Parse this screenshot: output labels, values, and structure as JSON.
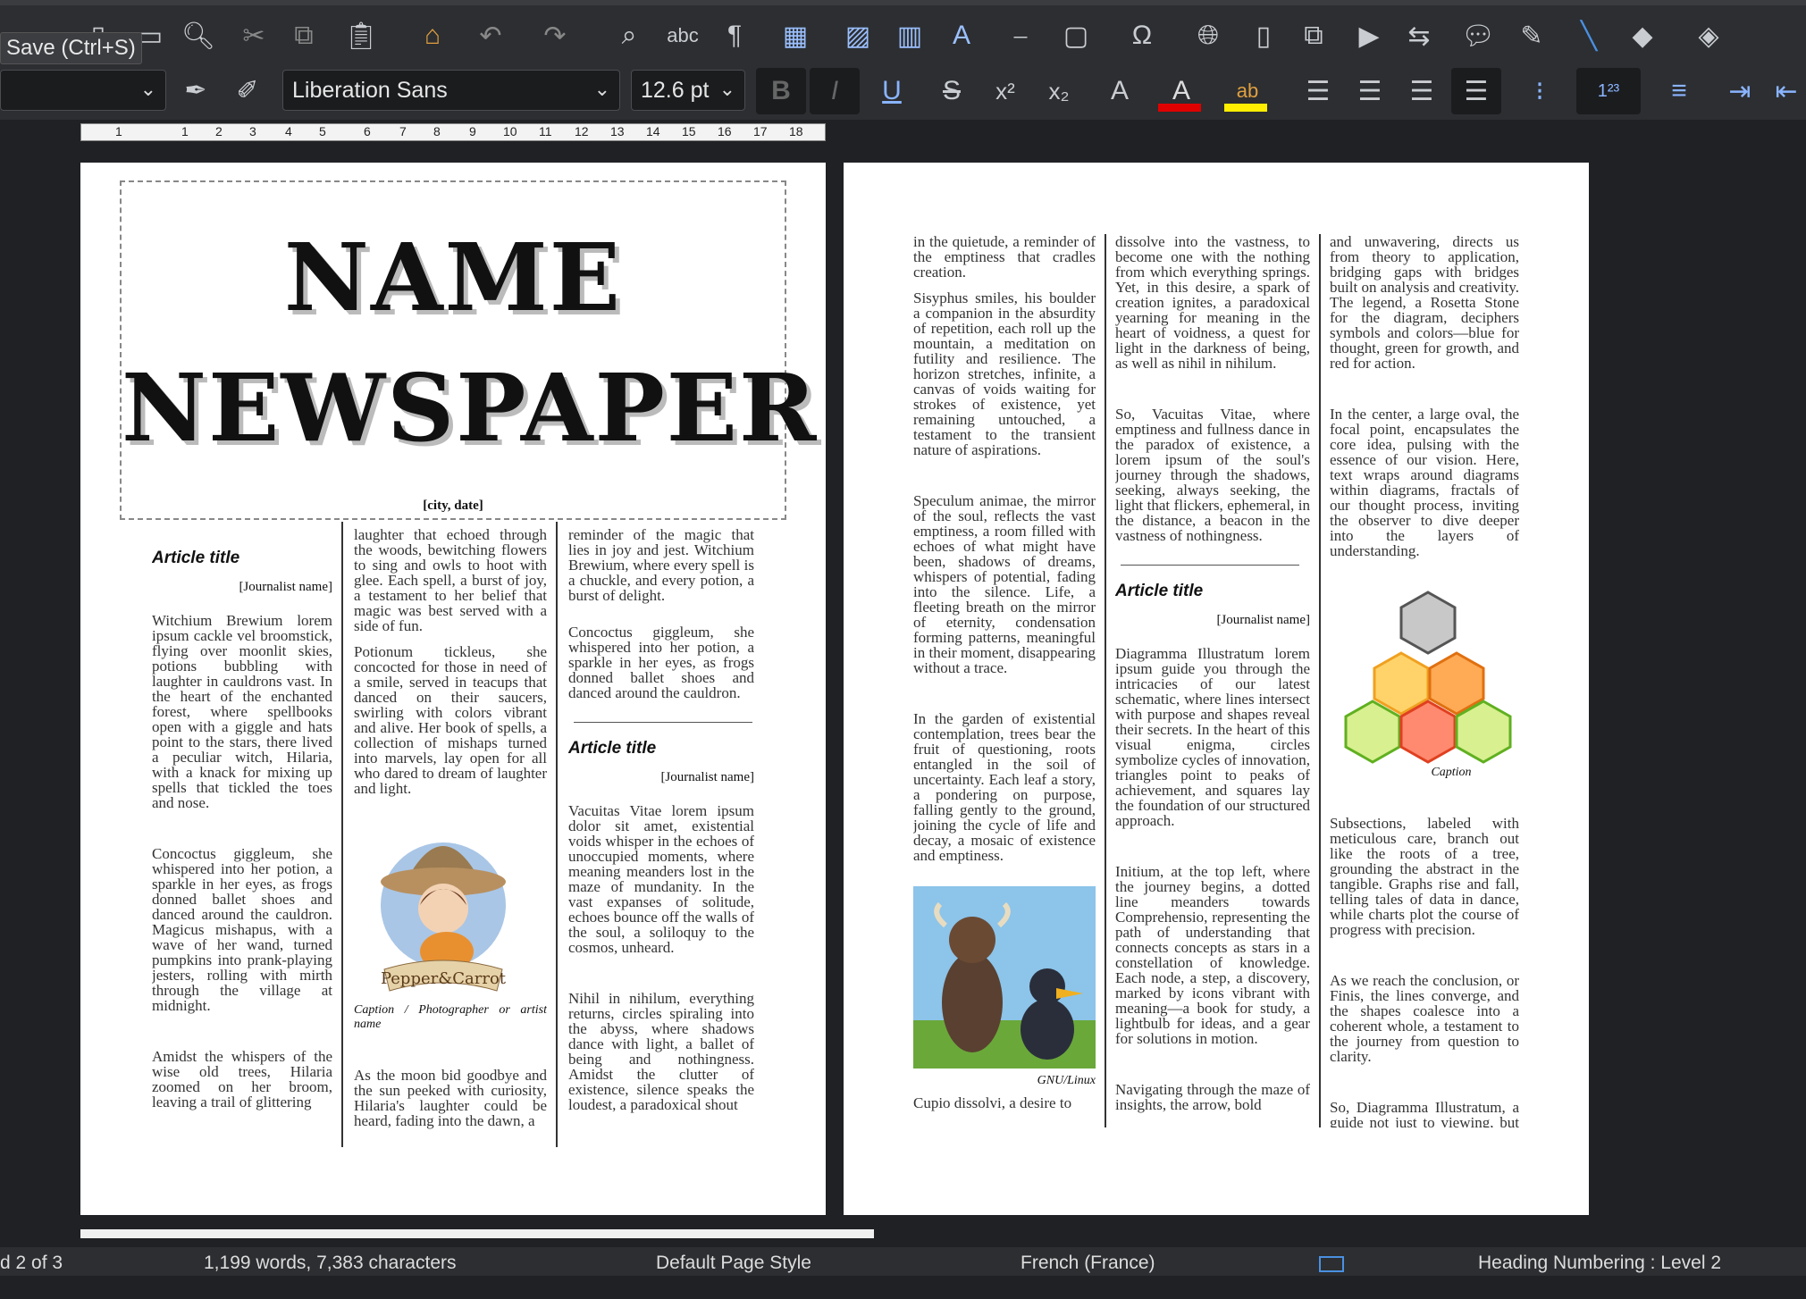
{
  "tooltip": "Save (Ctrl+S)",
  "format": {
    "font_name": "Liberation Sans",
    "font_size": "12.6 pt"
  },
  "ruler": {
    "marks": [
      "1",
      "1",
      "2",
      "3",
      "4",
      "5",
      "6",
      "7",
      "8",
      "9",
      "10",
      "11",
      "12",
      "13",
      "14",
      "15",
      "16",
      "17",
      "18"
    ]
  },
  "page1": {
    "masthead_line1": "NAME",
    "masthead_line2": "NEWSPAPER",
    "city_date": "[city, date]",
    "col1": {
      "title": "Article title",
      "journalist": "[Journalist name]",
      "p1": "Witchium Brewium lorem ipsum cackle vel broomstick, flying over moonlit skies, potions bubbling with laughter in cauldrons vast. In the heart of the enchanted forest, where spellbooks open with a giggle and hats point to the stars, there lived a peculiar witch, Hilaria, with a knack for mixing up spells that tickled the toes and nose.",
      "p2": "Concoctus giggleum, she whispered into her potion, a sparkle in her eyes, as frogs donned ballet shoes and danced around the cauldron. Magicus mishapus, with a wave of her wand, turned pumpkins into prank-playing jesters, rolling with mirth through the village at midnight.",
      "p3": "Amidst the whispers of the wise old trees, Hilaria zoomed on her broom, leaving a trail of glittering"
    },
    "col2": {
      "p1": "laughter that echoed through the woods, bewitching flowers to sing and owls to hoot with glee. Each spell, a burst of joy, a testament to her belief that magic was best served with a side of fun.",
      "p2": "Potionum tickleus, she concocted for those in need of a smile, served in teacups that danced on their saucers, swirling with colors vibrant and alive. Her book of spells, a collection of mishaps turned into marvels, lay open for all who dared to dream of laughter and light.",
      "caption": "Caption / Photographer or artist name",
      "p3": "As the moon bid goodbye and the sun peeked with curiosity, Hilaria's laughter could be heard, fading into the dawn, a"
    },
    "col3": {
      "p1": "reminder of the magic that lies in joy and jest. Witchium Brewium, where every spell is a chuckle, and every potion, a burst of delight.",
      "p2": "Concoctus giggleum, she whispered into her potion, a sparkle in her eyes, as frogs donned ballet shoes and danced around the cauldron.",
      "title": "Article title",
      "journalist": "[Journalist name]",
      "p3": "Vacuitas Vitae lorem ipsum dolor sit amet, existential voids whisper in the echoes of unoccupied moments, where meaning meanders lost in the maze of mundanity. In the vast expanses of solitude, echoes bounce off the walls of the soul, a soliloquy to the cosmos, unheard.",
      "p4": "Nihil in nihilum, everything returns, circles spiraling into the abyss, where shadows dance with light, a ballet of being and nothingness. Amidst the clutter of existence, silence speaks the loudest, a paradoxical shout"
    }
  },
  "page2": {
    "col1": {
      "p1": "in the quietude, a reminder of the emptiness that cradles creation.",
      "p2": "Sisyphus smiles, his boulder a companion in the absurdity of repetition, each roll up the mountain, a meditation on futility and resilience. The horizon stretches, infinite, a canvas of voids waiting for strokes of existence, yet remaining untouched, a testament to the transient nature of aspirations.",
      "p3": "Speculum animae, the mirror of the soul, reflects the vast emptiness, a room filled with echoes of what might have been, shadows of dreams, whispers of potential, fading into the silence. Life, a fleeting breath on the mirror of eternity, condensation forming patterns, meaningful in their moment, disappearing without a trace.",
      "p4": "In the garden of existential contemplation, trees bear the fruit of questioning, roots entangled in the soil of uncertainty. Each leaf a story, a pondering on purpose, falling gently to the ground, joining the cycle of life and decay, a mosaic of existence and emptiness.",
      "caption": "GNU/Linux",
      "p5": "Cupio dissolvi, a desire to"
    },
    "col2": {
      "p1": "dissolve into the vastness, to become one with the nothing from which everything springs. Yet, in this desire, a spark of creation ignites, a paradoxical yearning for meaning in the heart of voidness, a quest for light in the darkness of being, as well as nihil in nihilum.",
      "p2": "So, Vacuitas Vitae, where emptiness and fullness dance in the paradox of existence, a lorem ipsum of the soul's journey through the shadows, seeking, always seeking, the light that flickers, ephemeral, in the distance, a beacon in the vastness of nothingness.",
      "title": "Article title",
      "journalist": "[Journalist name]",
      "p3": "Diagramma Illustratum lorem ipsum guide you through the intricacies of our latest schematic, where lines intersect with purpose and shapes reveal their secrets. In the heart of this visual enigma, circles symbolize cycles of innovation, triangles point to peaks of achievement, and squares lay the foundation of our structured approach.",
      "p4": "Initium, at the top left, where the journey begins, a dotted line meanders towards Comprehensio, representing the path of understanding that connects concepts as stars in a constellation of knowledge. Each node, a step, a discovery, marked by icons vibrant with meaning—a book for study, a lightbulb for ideas, and a gear for solutions in motion.",
      "p5": "Navigating through the maze of insights, the arrow, bold"
    },
    "col3": {
      "p1": "and unwavering, directs us from theory to application, bridging gaps with bridges built on analysis and creativity. The legend, a Rosetta Stone for the diagram, deciphers symbols and colors—blue for thought, green for growth, and red for action.",
      "p2": "In the center, a large oval, the focal point, encapsulates the core idea, pulsing with the essence of our vision. Here, text wraps around diagrams within diagrams, fractals of our thought process, inviting the observer to dive deeper into the layers of understanding.",
      "caption": "Caption",
      "p3": "Subsections, labeled with meticulous care, branch out like the roots of a tree, grounding the abstract in the tangible. Graphs rise and fall, telling tales of data in dance, while charts plot the course of progress with precision.",
      "p4": "As we reach the conclusion, or Finis, the lines converge, and the shapes coalesce into a coherent whole, a testament to the journey from question to clarity.",
      "p5": "So, Diagramma Illustratum, a guide not just to viewing, but understanding, where every"
    }
  },
  "status": {
    "page": "d 2 of 3",
    "words": "1,199 words, 7,383 characters",
    "page_style": "Default Page Style",
    "language": "French (France)",
    "heading": "Heading Numbering : Level 2"
  },
  "colors": {
    "font_color": "#e00000",
    "highlight": "#ffee00",
    "hex_gray": "#c8c8c8",
    "hex_yellow": "#ffd36a",
    "hex_orange": "#ffaa55",
    "hex_red": "#ff8a70",
    "hex_green": "#d8f090"
  }
}
